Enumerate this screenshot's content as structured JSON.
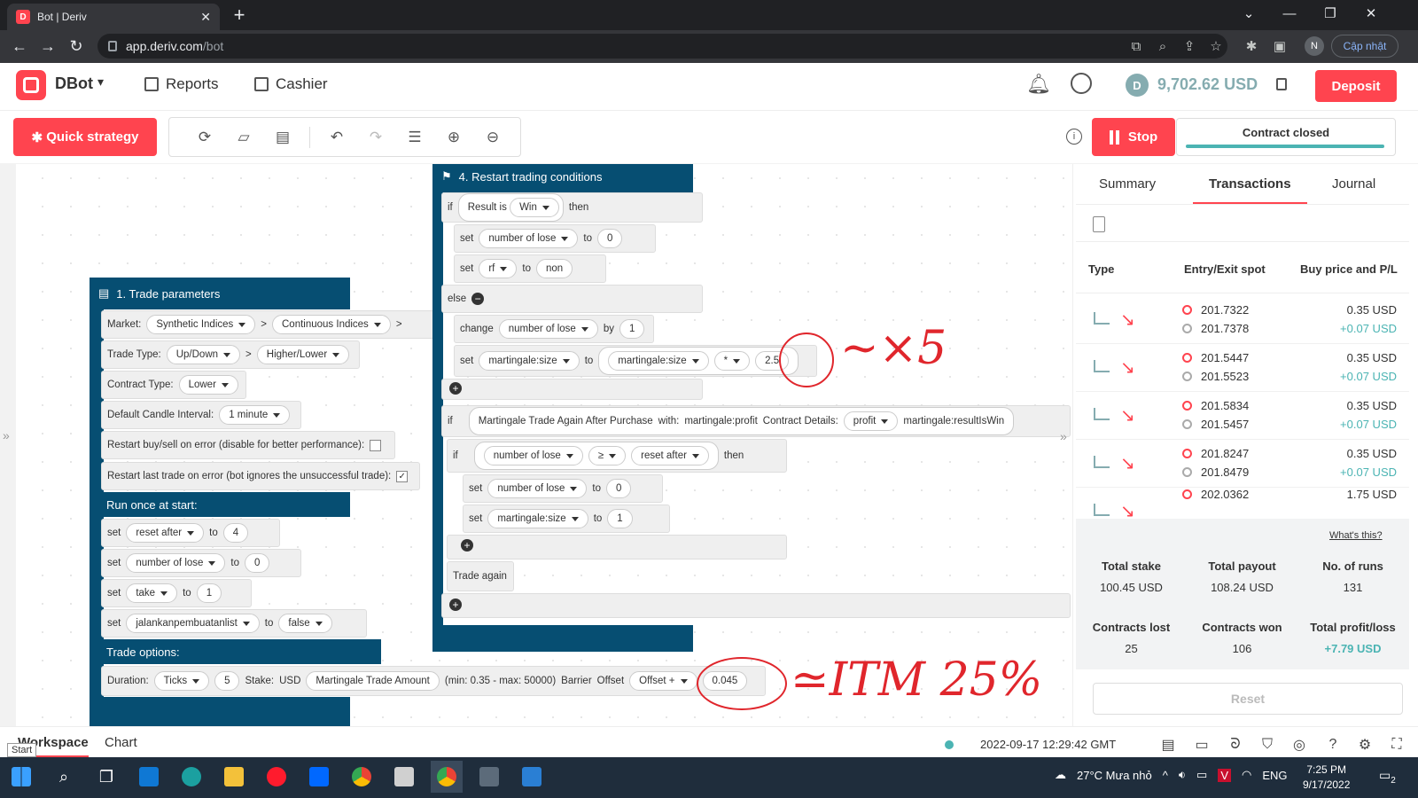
{
  "browser": {
    "tab_title": "Bot | Deriv",
    "tab_icon_letter": "D",
    "url_domain": "app.deriv.com",
    "url_path": "/bot",
    "profile_initial": "N",
    "update_label": "Cập nhật"
  },
  "header": {
    "app_name": "DBot",
    "menu": [
      "Reports",
      "Cashier"
    ],
    "balance": "9,702.62 USD",
    "deposit_label": "Deposit"
  },
  "toolbar": {
    "quick_strategy": "Quick strategy",
    "stop_label": "Stop",
    "contract_status": "Contract closed"
  },
  "blocks": {
    "trade_params_title": "1. Trade parameters",
    "market_label": "Market:",
    "market_values": [
      "Synthetic Indices",
      "Continuous Indices"
    ],
    "trade_type_label": "Trade Type:",
    "trade_type_values": [
      "Up/Down",
      "Higher/Lower"
    ],
    "contract_type_label": "Contract Type:",
    "contract_type_value": "Lower",
    "candle_label": "Default Candle Interval:",
    "candle_value": "1 minute",
    "restart_error_label": "Restart buy/sell on error (disable for better performance):",
    "restart_last_label": "Restart last trade on error (bot ignores the unsuccessful trade):",
    "run_once_title": "Run once at start:",
    "run_once_rows": [
      {
        "verb": "set",
        "var": "reset after",
        "to": "to",
        "val": "4"
      },
      {
        "verb": "set",
        "var": "number of lose",
        "to": "to",
        "val": "0"
      },
      {
        "verb": "set",
        "var": "take",
        "to": "to",
        "val": "1"
      },
      {
        "verb": "set",
        "var": "jalankanpembuatanlist",
        "to": "to",
        "val": "false"
      }
    ],
    "trade_options_title": "Trade options:",
    "duration_label": "Duration:",
    "duration_unit": "Ticks",
    "duration_value": "5",
    "stake_label": "Stake:",
    "stake_currency": "USD",
    "stake_var": "Martingale Trade Amount",
    "stake_range": "(min: 0.35 - max: 50000)",
    "barrier_label": "Barrier",
    "offset_label": "Offset",
    "offset_value": "Offset +",
    "barrier_value": "0.045",
    "restart_title": "4. Restart trading conditions",
    "if_label": "if",
    "then_label": "then",
    "else_label": "else",
    "result_is": "Result is",
    "result_value": "Win",
    "set1_var": "number of lose",
    "set1_val": "0",
    "set2_var": "rf",
    "set2_val": "non",
    "change_label": "change",
    "change_var": "number of lose",
    "by_label": "by",
    "change_val": "1",
    "set3_var": "martingale:size",
    "set3_inner": "martingale:size",
    "set3_op": "*",
    "set3_val": "2.5",
    "martingale_label": "Martingale Trade Again After Purchase",
    "with_label": "with:",
    "with_value": "martingale:profit",
    "contract_details_label": "Contract Details:",
    "contract_details_value": "profit",
    "result_is_win": "martingale:resultIsWin",
    "cmp_left": "number of lose",
    "cmp_op": "≥",
    "cmp_right": "reset after",
    "set4_var": "number of lose",
    "set4_val": "0",
    "set5_var": "martingale:size",
    "set5_val": "1",
    "trade_again": "Trade again",
    "to_label": "to",
    "set_label": "set"
  },
  "annotations": {
    "note1": "~×5",
    "note2": "≃ITM 25%"
  },
  "panel": {
    "tabs": [
      "Summary",
      "Transactions",
      "Journal"
    ],
    "columns": [
      "Type",
      "Entry/Exit spot",
      "Buy price and P/L"
    ],
    "transactions": [
      {
        "entry": "201.7322",
        "exit": "201.7378",
        "price": "0.35 USD",
        "pl": "+0.07 USD"
      },
      {
        "entry": "201.5447",
        "exit": "201.5523",
        "price": "0.35 USD",
        "pl": "+0.07 USD"
      },
      {
        "entry": "201.5834",
        "exit": "201.5457",
        "price": "0.35 USD",
        "pl": "+0.07 USD"
      },
      {
        "entry": "201.8247",
        "exit": "201.8479",
        "price": "0.35 USD",
        "pl": "+0.07 USD"
      },
      {
        "entry": "202.0362",
        "exit": "",
        "price": "1.75 USD",
        "pl": ""
      }
    ],
    "whats_this": "What's this?",
    "stats": [
      {
        "label": "Total stake",
        "value": "100.45 USD"
      },
      {
        "label": "Total payout",
        "value": "108.24 USD"
      },
      {
        "label": "No. of runs",
        "value": "131"
      },
      {
        "label": "Contracts lost",
        "value": "25"
      },
      {
        "label": "Contracts won",
        "value": "106"
      },
      {
        "label": "Total profit/loss",
        "value": "+7.79 USD"
      }
    ],
    "reset_label": "Reset"
  },
  "footer": {
    "tabs": [
      "Workspace",
      "Chart"
    ],
    "start_tooltip": "Start",
    "timestamp": "2022-09-17 12:29:42 GMT"
  },
  "taskbar": {
    "weather": "27°C  Mưa nhỏ",
    "lang": "ENG",
    "time": "7:25 PM",
    "date": "9/17/2022",
    "notif_count": "2"
  },
  "colors": {
    "brand": "#ff444f",
    "block": "#064e72",
    "teal": "#4bb4b3",
    "annotation": "#e0262c"
  }
}
